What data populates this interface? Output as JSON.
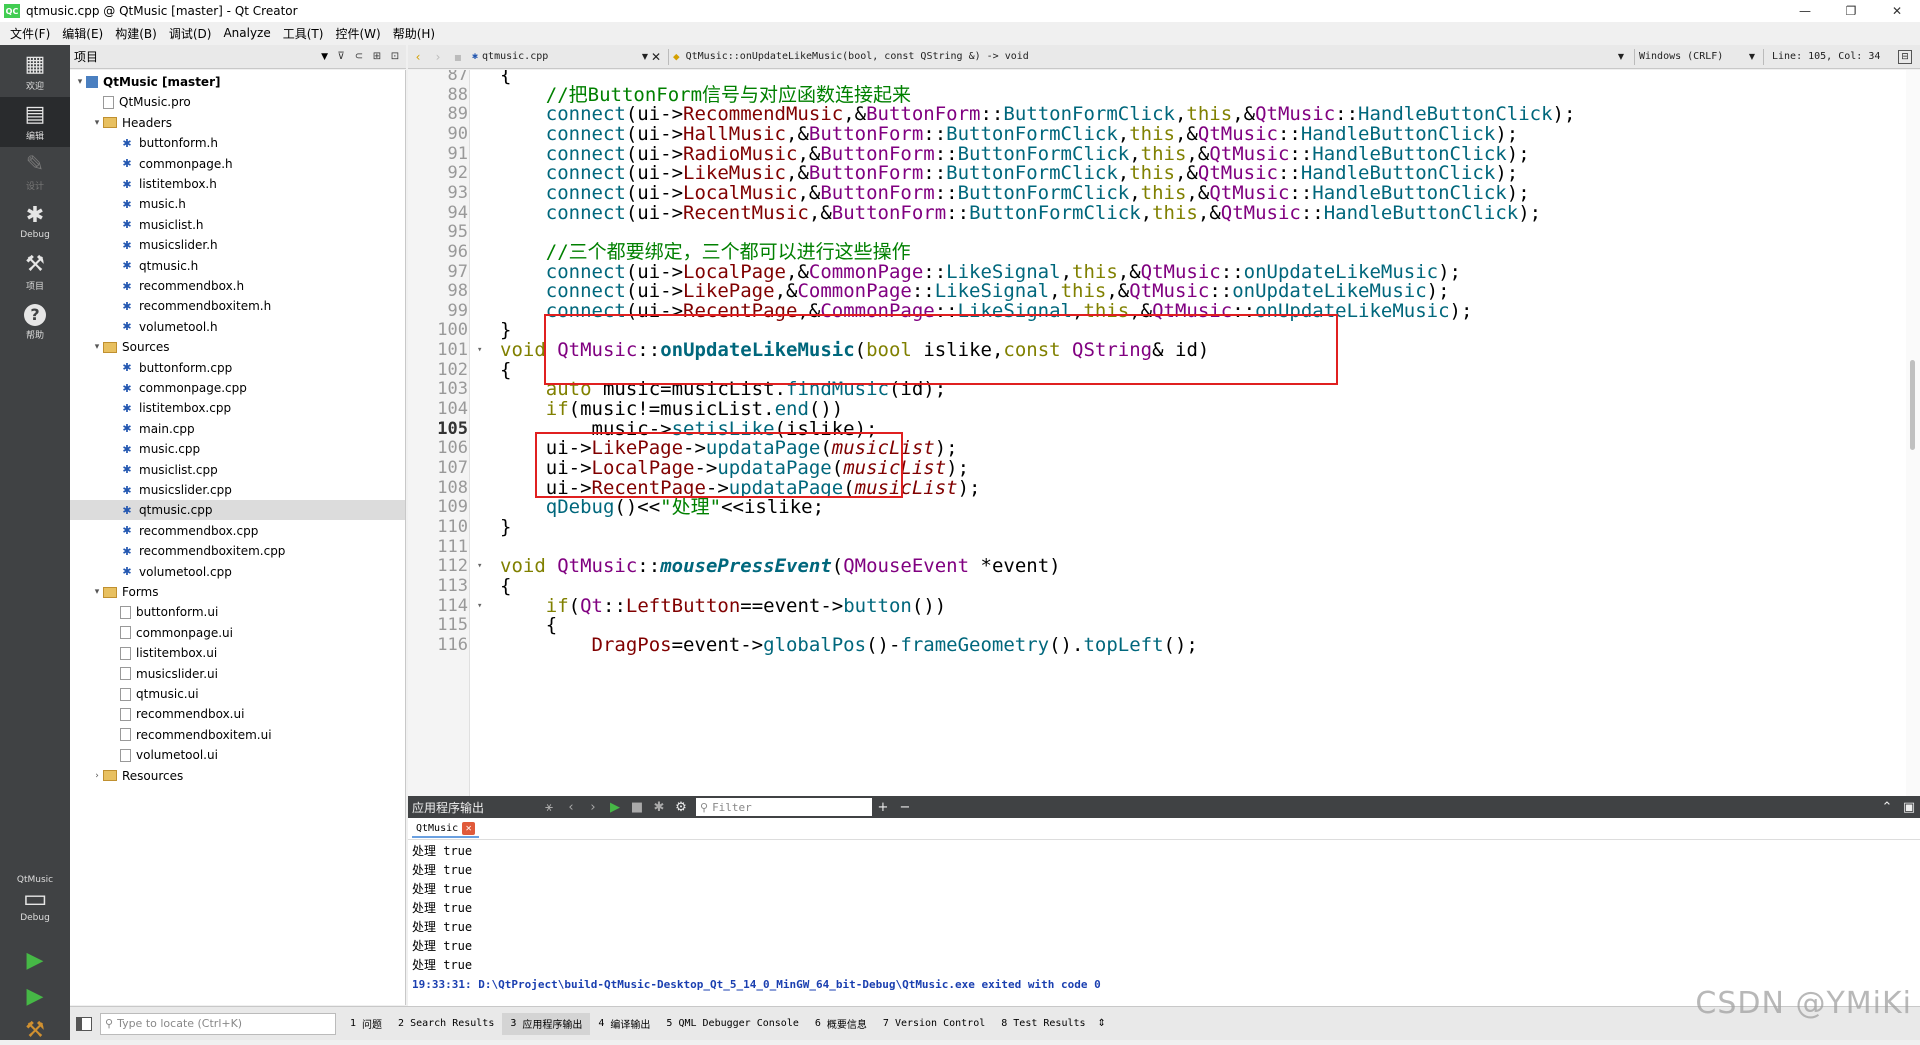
{
  "window": {
    "title": "qtmusic.cpp @ QtMusic [master] - Qt Creator",
    "app_icon": "QC",
    "minimize": "—",
    "maximize": "❐",
    "close": "✕"
  },
  "menu": [
    "文件(F)",
    "编辑(E)",
    "构建(B)",
    "调试(D)",
    "Analyze",
    "工具(T)",
    "控件(W)",
    "帮助(H)"
  ],
  "modes": [
    {
      "name": "welcome",
      "icon": "grid-icon",
      "glyph": "▦",
      "label": "欢迎"
    },
    {
      "name": "edit",
      "icon": "edit-icon",
      "glyph": "▤",
      "label": "编辑",
      "active": true
    },
    {
      "name": "design",
      "icon": "pencil-icon",
      "glyph": "✎",
      "label": "设计",
      "disabled": true
    },
    {
      "name": "debug",
      "icon": "bug-icon",
      "glyph": "✱",
      "label": "Debug"
    },
    {
      "name": "projects",
      "icon": "wrench-icon",
      "glyph": "⚒",
      "label": "项目"
    },
    {
      "name": "help",
      "icon": "help-icon",
      "glyph": "?",
      "label": "帮助"
    }
  ],
  "kit": {
    "project": "QtMusic",
    "config": "Debug",
    "glyph": "▭"
  },
  "run_buttons": {
    "run": "▶",
    "debug_run": "▶",
    "build": "⚒"
  },
  "project_panel": {
    "title": "项目",
    "tree": [
      {
        "label": "QtMusic [master]",
        "level": 0,
        "type": "root",
        "expanded": true,
        "bold": true
      },
      {
        "label": "QtMusic.pro",
        "level": 1,
        "type": "pro"
      },
      {
        "label": "Headers",
        "level": 1,
        "type": "folder",
        "expanded": true
      },
      {
        "label": "buttonform.h",
        "level": 2,
        "type": "h"
      },
      {
        "label": "commonpage.h",
        "level": 2,
        "type": "h"
      },
      {
        "label": "listitembox.h",
        "level": 2,
        "type": "h"
      },
      {
        "label": "music.h",
        "level": 2,
        "type": "h"
      },
      {
        "label": "musiclist.h",
        "level": 2,
        "type": "h"
      },
      {
        "label": "musicslider.h",
        "level": 2,
        "type": "h"
      },
      {
        "label": "qtmusic.h",
        "level": 2,
        "type": "h"
      },
      {
        "label": "recommendbox.h",
        "level": 2,
        "type": "h"
      },
      {
        "label": "recommendboxitem.h",
        "level": 2,
        "type": "h"
      },
      {
        "label": "volumetool.h",
        "level": 2,
        "type": "h"
      },
      {
        "label": "Sources",
        "level": 1,
        "type": "folder",
        "expanded": true
      },
      {
        "label": "buttonform.cpp",
        "level": 2,
        "type": "cpp"
      },
      {
        "label": "commonpage.cpp",
        "level": 2,
        "type": "cpp"
      },
      {
        "label": "listitembox.cpp",
        "level": 2,
        "type": "cpp"
      },
      {
        "label": "main.cpp",
        "level": 2,
        "type": "cpp"
      },
      {
        "label": "music.cpp",
        "level": 2,
        "type": "cpp"
      },
      {
        "label": "musiclist.cpp",
        "level": 2,
        "type": "cpp"
      },
      {
        "label": "musicslider.cpp",
        "level": 2,
        "type": "cpp"
      },
      {
        "label": "qtmusic.cpp",
        "level": 2,
        "type": "cpp",
        "selected": true
      },
      {
        "label": "recommendbox.cpp",
        "level": 2,
        "type": "cpp"
      },
      {
        "label": "recommendboxitem.cpp",
        "level": 2,
        "type": "cpp"
      },
      {
        "label": "volumetool.cpp",
        "level": 2,
        "type": "cpp"
      },
      {
        "label": "Forms",
        "level": 1,
        "type": "folder",
        "expanded": true
      },
      {
        "label": "buttonform.ui",
        "level": 2,
        "type": "ui"
      },
      {
        "label": "commonpage.ui",
        "level": 2,
        "type": "ui"
      },
      {
        "label": "listitembox.ui",
        "level": 2,
        "type": "ui"
      },
      {
        "label": "musicslider.ui",
        "level": 2,
        "type": "ui"
      },
      {
        "label": "qtmusic.ui",
        "level": 2,
        "type": "ui"
      },
      {
        "label": "recommendbox.ui",
        "level": 2,
        "type": "ui"
      },
      {
        "label": "recommendboxitem.ui",
        "level": 2,
        "type": "ui"
      },
      {
        "label": "volumetool.ui",
        "level": 2,
        "type": "ui"
      },
      {
        "label": "Resources",
        "level": 1,
        "type": "folder",
        "expanded": false
      }
    ]
  },
  "editor_toolbar": {
    "file": "qtmusic.cpp",
    "symbol": "QtMusic::onUpdateLikeMusic(bool, const QString &) -> void",
    "encoding": "Windows (CRLF)",
    "position": "Line: 105, Col: 34"
  },
  "colors": {
    "keyword": "#808000",
    "type": "#800080",
    "comment": "#008000",
    "string": "#008000",
    "func": "#00677c",
    "member": "#800000",
    "param": "#092e64",
    "italic_param": "#092e64",
    "highlight_box": "#e02020"
  },
  "code_lines": [
    {
      "n": "87",
      "t": [
        [
          "{",
          "p"
        ]
      ]
    },
    {
      "n": "88",
      "t": [
        [
          "    //把ButtonForm信号与对应函数连接起来",
          "c"
        ]
      ]
    },
    {
      "n": "89",
      "t": [
        [
          "    ",
          "p"
        ],
        [
          "connect",
          "f"
        ],
        [
          "(ui->",
          "p"
        ],
        [
          "RecommendMusic",
          "m"
        ],
        [
          ",&",
          "p"
        ],
        [
          "ButtonForm",
          "y"
        ],
        [
          "::",
          "p"
        ],
        [
          "ButtonFormClick",
          "f"
        ],
        [
          ",",
          "p"
        ],
        [
          "this",
          "k"
        ],
        [
          ",&",
          "p"
        ],
        [
          "QtMusic",
          "y"
        ],
        [
          "::",
          "p"
        ],
        [
          "HandleButtonClick",
          "f"
        ],
        [
          ");",
          "p"
        ]
      ]
    },
    {
      "n": "90",
      "t": [
        [
          "    ",
          "p"
        ],
        [
          "connect",
          "f"
        ],
        [
          "(ui->",
          "p"
        ],
        [
          "HallMusic",
          "m"
        ],
        [
          ",&",
          "p"
        ],
        [
          "ButtonForm",
          "y"
        ],
        [
          "::",
          "p"
        ],
        [
          "ButtonFormClick",
          "f"
        ],
        [
          ",",
          "p"
        ],
        [
          "this",
          "k"
        ],
        [
          ",&",
          "p"
        ],
        [
          "QtMusic",
          "y"
        ],
        [
          "::",
          "p"
        ],
        [
          "HandleButtonClick",
          "f"
        ],
        [
          ");",
          "p"
        ]
      ]
    },
    {
      "n": "91",
      "t": [
        [
          "    ",
          "p"
        ],
        [
          "connect",
          "f"
        ],
        [
          "(ui->",
          "p"
        ],
        [
          "RadioMusic",
          "m"
        ],
        [
          ",&",
          "p"
        ],
        [
          "ButtonForm",
          "y"
        ],
        [
          "::",
          "p"
        ],
        [
          "ButtonFormClick",
          "f"
        ],
        [
          ",",
          "p"
        ],
        [
          "this",
          "k"
        ],
        [
          ",&",
          "p"
        ],
        [
          "QtMusic",
          "y"
        ],
        [
          "::",
          "p"
        ],
        [
          "HandleButtonClick",
          "f"
        ],
        [
          ");",
          "p"
        ]
      ]
    },
    {
      "n": "92",
      "t": [
        [
          "    ",
          "p"
        ],
        [
          "connect",
          "f"
        ],
        [
          "(ui->",
          "p"
        ],
        [
          "LikeMusic",
          "m"
        ],
        [
          ",&",
          "p"
        ],
        [
          "ButtonForm",
          "y"
        ],
        [
          "::",
          "p"
        ],
        [
          "ButtonFormClick",
          "f"
        ],
        [
          ",",
          "p"
        ],
        [
          "this",
          "k"
        ],
        [
          ",&",
          "p"
        ],
        [
          "QtMusic",
          "y"
        ],
        [
          "::",
          "p"
        ],
        [
          "HandleButtonClick",
          "f"
        ],
        [
          ");",
          "p"
        ]
      ]
    },
    {
      "n": "93",
      "t": [
        [
          "    ",
          "p"
        ],
        [
          "connect",
          "f"
        ],
        [
          "(ui->",
          "p"
        ],
        [
          "LocalMusic",
          "m"
        ],
        [
          ",&",
          "p"
        ],
        [
          "ButtonForm",
          "y"
        ],
        [
          "::",
          "p"
        ],
        [
          "ButtonFormClick",
          "f"
        ],
        [
          ",",
          "p"
        ],
        [
          "this",
          "k"
        ],
        [
          ",&",
          "p"
        ],
        [
          "QtMusic",
          "y"
        ],
        [
          "::",
          "p"
        ],
        [
          "HandleButtonClick",
          "f"
        ],
        [
          ");",
          "p"
        ]
      ]
    },
    {
      "n": "94",
      "t": [
        [
          "    ",
          "p"
        ],
        [
          "connect",
          "f"
        ],
        [
          "(ui->",
          "p"
        ],
        [
          "RecentMusic",
          "m"
        ],
        [
          ",&",
          "p"
        ],
        [
          "ButtonForm",
          "y"
        ],
        [
          "::",
          "p"
        ],
        [
          "ButtonFormClick",
          "f"
        ],
        [
          ",",
          "p"
        ],
        [
          "this",
          "k"
        ],
        [
          ",&",
          "p"
        ],
        [
          "QtMusic",
          "y"
        ],
        [
          "::",
          "p"
        ],
        [
          "HandleButtonClick",
          "f"
        ],
        [
          ");",
          "p"
        ]
      ]
    },
    {
      "n": "95",
      "t": []
    },
    {
      "n": "96",
      "t": [
        [
          "    //三个都要绑定，三个都可以进行这些操作",
          "c"
        ]
      ]
    },
    {
      "n": "97",
      "t": [
        [
          "    ",
          "p"
        ],
        [
          "connect",
          "f"
        ],
        [
          "(ui->",
          "p"
        ],
        [
          "LocalPage",
          "m"
        ],
        [
          ",&",
          "p"
        ],
        [
          "CommonPage",
          "y"
        ],
        [
          "::",
          "p"
        ],
        [
          "LikeSignal",
          "f"
        ],
        [
          ",",
          "p"
        ],
        [
          "this",
          "k"
        ],
        [
          ",&",
          "p"
        ],
        [
          "QtMusic",
          "y"
        ],
        [
          "::",
          "p"
        ],
        [
          "onUpdateLikeMusic",
          "f"
        ],
        [
          ");",
          "p"
        ]
      ]
    },
    {
      "n": "98",
      "t": [
        [
          "    ",
          "p"
        ],
        [
          "connect",
          "f"
        ],
        [
          "(ui->",
          "p"
        ],
        [
          "LikePage",
          "m"
        ],
        [
          ",&",
          "p"
        ],
        [
          "CommonPage",
          "y"
        ],
        [
          "::",
          "p"
        ],
        [
          "LikeSignal",
          "f"
        ],
        [
          ",",
          "p"
        ],
        [
          "this",
          "k"
        ],
        [
          ",&",
          "p"
        ],
        [
          "QtMusic",
          "y"
        ],
        [
          "::",
          "p"
        ],
        [
          "onUpdateLikeMusic",
          "f"
        ],
        [
          ");",
          "p"
        ]
      ]
    },
    {
      "n": "99",
      "t": [
        [
          "    ",
          "p"
        ],
        [
          "connect",
          "f"
        ],
        [
          "(ui->",
          "p"
        ],
        [
          "RecentPage",
          "m"
        ],
        [
          ",&",
          "p"
        ],
        [
          "CommonPage",
          "y"
        ],
        [
          "::",
          "p"
        ],
        [
          "LikeSignal",
          "f"
        ],
        [
          ",",
          "p"
        ],
        [
          "this",
          "k"
        ],
        [
          ",&",
          "p"
        ],
        [
          "QtMusic",
          "y"
        ],
        [
          "::",
          "p"
        ],
        [
          "onUpdateLikeMusic",
          "f"
        ],
        [
          ");",
          "p"
        ]
      ]
    },
    {
      "n": "100",
      "t": [
        [
          "}",
          "p"
        ]
      ]
    },
    {
      "n": "101",
      "fold": true,
      "t": [
        [
          "void",
          "k"
        ],
        [
          " ",
          "p"
        ],
        [
          "QtMusic",
          "y"
        ],
        [
          "::",
          "p"
        ],
        [
          "onUpdateLikeMusic",
          "fb"
        ],
        [
          "(",
          "p"
        ],
        [
          "bool",
          "k"
        ],
        [
          " islike,",
          "p"
        ],
        [
          "const",
          "k"
        ],
        [
          " ",
          "p"
        ],
        [
          "QString",
          "y"
        ],
        [
          "& id)",
          "p"
        ]
      ]
    },
    {
      "n": "102",
      "t": [
        [
          "{",
          "p"
        ]
      ]
    },
    {
      "n": "103",
      "t": [
        [
          "    ",
          "p"
        ],
        [
          "auto",
          "k"
        ],
        [
          " music=musicList.",
          "p"
        ],
        [
          "findMusic",
          "f"
        ],
        [
          "(id);",
          "p"
        ]
      ]
    },
    {
      "n": "104",
      "t": [
        [
          "    ",
          "p"
        ],
        [
          "if",
          "k"
        ],
        [
          "(music!=musicList.",
          "p"
        ],
        [
          "end",
          "f"
        ],
        [
          "())",
          "p"
        ]
      ]
    },
    {
      "n": "105",
      "cur": true,
      "t": [
        [
          "        music->",
          "p"
        ],
        [
          "setisLike",
          "f"
        ],
        [
          "(islike);",
          "p"
        ]
      ]
    },
    {
      "n": "106",
      "t": [
        [
          "    ui->",
          "p"
        ],
        [
          "LikePage",
          "m"
        ],
        [
          "->",
          "p"
        ],
        [
          "updataPage",
          "f"
        ],
        [
          "(",
          "p"
        ],
        [
          "musicList",
          "i"
        ],
        [
          ");",
          "p"
        ]
      ]
    },
    {
      "n": "107",
      "t": [
        [
          "    ui->",
          "p"
        ],
        [
          "LocalPage",
          "m"
        ],
        [
          "->",
          "p"
        ],
        [
          "updataPage",
          "f"
        ],
        [
          "(",
          "p"
        ],
        [
          "musicList",
          "i"
        ],
        [
          ");",
          "p"
        ]
      ]
    },
    {
      "n": "108",
      "t": [
        [
          "    ui->",
          "p"
        ],
        [
          "RecentPage",
          "m"
        ],
        [
          "->",
          "p"
        ],
        [
          "updataPage",
          "f"
        ],
        [
          "(",
          "p"
        ],
        [
          "musicList",
          "i"
        ],
        [
          ");",
          "p"
        ]
      ]
    },
    {
      "n": "109",
      "t": [
        [
          "    ",
          "p"
        ],
        [
          "qDebug",
          "f"
        ],
        [
          "()<<",
          "p"
        ],
        [
          "\"处理\"",
          "s"
        ],
        [
          "<<islike;",
          "p"
        ]
      ]
    },
    {
      "n": "110",
      "t": [
        [
          "}",
          "p"
        ]
      ]
    },
    {
      "n": "111",
      "t": []
    },
    {
      "n": "112",
      "fold": true,
      "t": [
        [
          "void",
          "k"
        ],
        [
          " ",
          "p"
        ],
        [
          "QtMusic",
          "y"
        ],
        [
          "::",
          "p"
        ],
        [
          "mousePressEvent",
          "fi"
        ],
        [
          "(",
          "p"
        ],
        [
          "QMouseEvent",
          "y"
        ],
        [
          " *event)",
          "p"
        ]
      ]
    },
    {
      "n": "113",
      "t": [
        [
          "{",
          "p"
        ]
      ]
    },
    {
      "n": "114",
      "fold": true,
      "t": [
        [
          "    ",
          "p"
        ],
        [
          "if",
          "k"
        ],
        [
          "(",
          "p"
        ],
        [
          "Qt",
          "y"
        ],
        [
          "::",
          "p"
        ],
        [
          "LeftButton",
          "m"
        ],
        [
          "==event->",
          "p"
        ],
        [
          "button",
          "f"
        ],
        [
          "())",
          "p"
        ]
      ]
    },
    {
      "n": "115",
      "t": [
        [
          "    {",
          "p"
        ]
      ]
    },
    {
      "n": "116",
      "t": [
        [
          "        ",
          "p"
        ],
        [
          "DragPos",
          "m"
        ],
        [
          "=event->",
          "p"
        ],
        [
          "globalPos",
          "f"
        ],
        [
          "()-",
          "p"
        ],
        [
          "frameGeometry",
          "f"
        ],
        [
          "().",
          "p"
        ],
        [
          "topLeft",
          "f"
        ],
        [
          "();",
          "p"
        ]
      ]
    }
  ],
  "output": {
    "title": "应用程序输出",
    "filter_placeholder": "Filter",
    "tab": "QtMusic",
    "tab_close": "✕",
    "lines": [
      "处理 true",
      "处理 true",
      "处理 true",
      "处理 true",
      "处理 true",
      "处理 true",
      "处理 true"
    ],
    "exit_line": "19:33:31: D:\\QtProject\\build-QtMusic-Desktop_Qt_5_14_0_MinGW_64_bit-Debug\\QtMusic.exe exited with code 0"
  },
  "statusbar": {
    "locate_placeholder": "Type to locate (Ctrl+K)",
    "tabs": [
      {
        "n": "1",
        "label": "问题"
      },
      {
        "n": "2",
        "label": "Search Results"
      },
      {
        "n": "3",
        "label": "应用程序输出",
        "active": true
      },
      {
        "n": "4",
        "label": "编译输出"
      },
      {
        "n": "5",
        "label": "QML Debugger Console"
      },
      {
        "n": "6",
        "label": "概要信息"
      },
      {
        "n": "7",
        "label": "Version Control"
      },
      {
        "n": "8",
        "label": "Test Results"
      }
    ]
  },
  "watermark": "CSDN @YMiKi"
}
